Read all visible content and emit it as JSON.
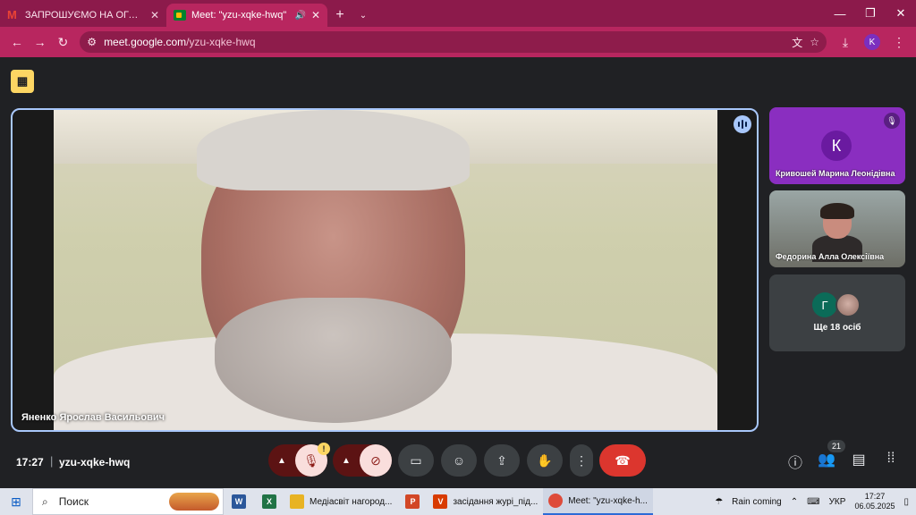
{
  "browser": {
    "tabs": [
      {
        "title": "ЗАПРОШУЄМО НА ОГОЛОШЕ",
        "favicon": "gmail-icon",
        "active": false
      },
      {
        "title": "Meet: \"yzu-xqke-hwq\"",
        "favicon": "meet-icon",
        "active": true
      }
    ],
    "url": "meet.google.com",
    "url_path": "/yzu-xqke-hwq",
    "profile_initial": "K",
    "theme_color": "#b8265f"
  },
  "meeting": {
    "main_speaker": "Яненко Ярослав Васильович",
    "participants": [
      {
        "name": "Кривошей Марина Леонідівна",
        "initial": "К"
      },
      {
        "name": "Федорина Алла Олексіївна"
      }
    ],
    "others_initial": "Г",
    "others_label": "Ще 18 осіб",
    "time": "17:27",
    "code": "yzu-xqke-hwq",
    "participant_count": "21",
    "mic_warning": "!",
    "end_call_color": "#dc362e"
  },
  "taskbar": {
    "search_placeholder": "Поиск",
    "apps": [
      {
        "label": "Медіасвіт нагород..."
      },
      {
        "label": "засідання журі_під..."
      },
      {
        "label": "Meet: \"yzu-xqke-h..."
      }
    ],
    "weather": "Rain coming",
    "language": "УКР",
    "clock_time": "17:27",
    "clock_date": "06.05.2025"
  }
}
